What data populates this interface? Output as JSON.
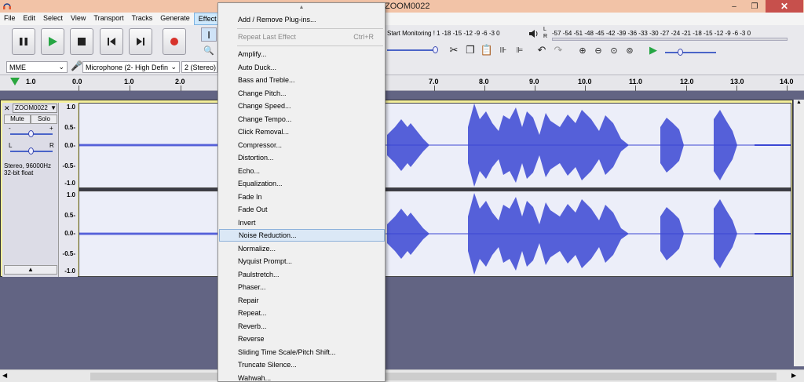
{
  "window": {
    "title": "ZOOM0022",
    "minimize": "–",
    "maximize": "❐",
    "close": "✕"
  },
  "menubar": [
    "File",
    "Edit",
    "Select",
    "View",
    "Transport",
    "Tracks",
    "Generate",
    "Effect"
  ],
  "meters": {
    "record_text": "Start Monitoring ! 1 -18 -15 -12 -9 -6 -3 0",
    "lr": "L R",
    "playback_scale": "-57 -54 -51 -48 -45 -42 -39 -36 -33 -30 -27 -24 -21 -18 -15 -12 -9 -6 -3 0"
  },
  "device": {
    "host": "MME",
    "input": "Microphone (2- High Defin",
    "channels": "2 (Stereo) R"
  },
  "timeline": {
    "play_head_value": "1.0",
    "ticks_left": [
      "0.0",
      "1.0",
      "2.0"
    ],
    "ticks_right": [
      "7.0",
      "8.0",
      "9.0",
      "10.0",
      "11.0",
      "12.0",
      "13.0",
      "14.0"
    ]
  },
  "track": {
    "name": "ZOOM0022",
    "mute": "Mute",
    "solo": "Solo",
    "gain_minus": "-",
    "gain_plus": "+",
    "pan_left": "L",
    "pan_right": "R",
    "info_line1": "Stereo, 96000Hz",
    "info_line2": "32-bit float",
    "vruler_top": [
      "1.0",
      "0.5-",
      "0.0-",
      "-0.5-",
      "-1.0"
    ],
    "vruler_bottom": [
      "1.0",
      "0.5-",
      "0.0-",
      "-0.5-",
      "-1.0"
    ]
  },
  "effect_menu": {
    "up_arrow": "▲",
    "items": [
      {
        "label": "Add / Remove Plug-ins...",
        "name": "add-remove-plugins"
      },
      {
        "label": "Repeat Last Effect",
        "shortcut": "Ctrl+R",
        "disabled": true,
        "name": "repeat-last-effect"
      },
      {
        "label": "Amplify...",
        "name": "amplify"
      },
      {
        "label": "Auto Duck...",
        "name": "auto-duck"
      },
      {
        "label": "Bass and Treble...",
        "name": "bass-and-treble"
      },
      {
        "label": "Change Pitch...",
        "name": "change-pitch"
      },
      {
        "label": "Change Speed...",
        "name": "change-speed"
      },
      {
        "label": "Change Tempo...",
        "name": "change-tempo"
      },
      {
        "label": "Click Removal...",
        "name": "click-removal"
      },
      {
        "label": "Compressor...",
        "name": "compressor"
      },
      {
        "label": "Distortion...",
        "name": "distortion"
      },
      {
        "label": "Echo...",
        "name": "echo"
      },
      {
        "label": "Equalization...",
        "name": "equalization"
      },
      {
        "label": "Fade In",
        "name": "fade-in"
      },
      {
        "label": "Fade Out",
        "name": "fade-out"
      },
      {
        "label": "Invert",
        "name": "invert"
      },
      {
        "label": "Noise Reduction...",
        "name": "noise-reduction",
        "hover": true
      },
      {
        "label": "Normalize...",
        "name": "normalize"
      },
      {
        "label": "Nyquist Prompt...",
        "name": "nyquist-prompt"
      },
      {
        "label": "Paulstretch...",
        "name": "paulstretch"
      },
      {
        "label": "Phaser...",
        "name": "phaser"
      },
      {
        "label": "Repair",
        "name": "repair"
      },
      {
        "label": "Repeat...",
        "name": "repeat"
      },
      {
        "label": "Reverb...",
        "name": "reverb"
      },
      {
        "label": "Reverse",
        "name": "reverse"
      },
      {
        "label": "Sliding Time Scale/Pitch Shift...",
        "name": "sliding-time-scale"
      },
      {
        "label": "Truncate Silence...",
        "name": "truncate-silence"
      },
      {
        "label": "Wahwah...",
        "name": "wahwah"
      }
    ]
  },
  "colors": {
    "titlebar": "#f2c3a7",
    "waveform": "#3b47d4",
    "track_bg": "#eceef9",
    "workspace": "#626483",
    "menu_hover": "#dbe8f6"
  }
}
